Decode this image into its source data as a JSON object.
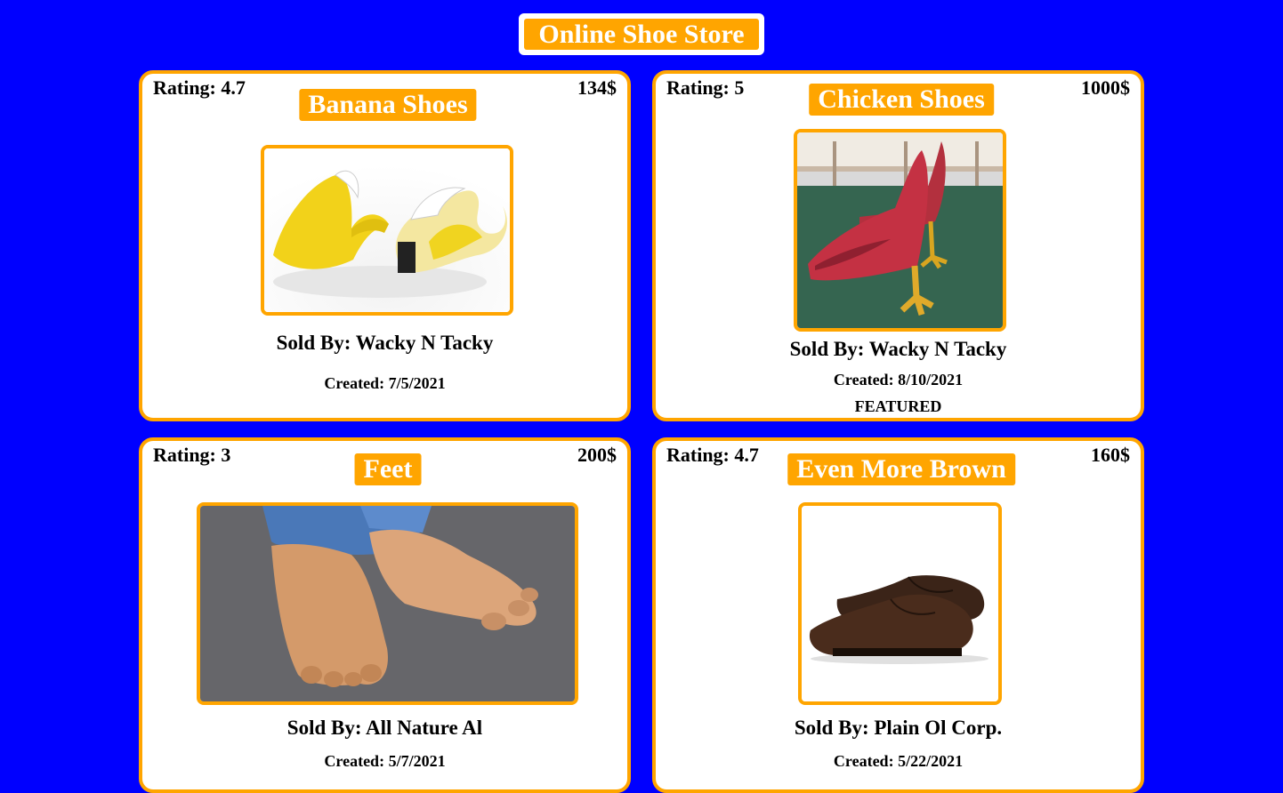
{
  "store": {
    "title": "Online Shoe Store"
  },
  "colors": {
    "background": "#0000ff",
    "accent": "#ffa500",
    "card": "#ffffff",
    "text": "#000000"
  },
  "products": [
    {
      "rating": "Rating: 4.7",
      "price": "134$",
      "name": "Banana Shoes",
      "seller": "Sold By: Wacky N Tacky",
      "created": "Created: 7/5/2021",
      "featured": "",
      "image_icon": "banana-shoes-image"
    },
    {
      "rating": "Rating: 5",
      "price": "1000$",
      "name": "Chicken Shoes",
      "seller": "Sold By: Wacky N Tacky",
      "created": "Created: 8/10/2021",
      "featured": "FEATURED",
      "image_icon": "chicken-shoes-image"
    },
    {
      "rating": "Rating: 3",
      "price": "200$",
      "name": "Feet",
      "seller": "Sold By: All Nature Al",
      "created": "Created: 5/7/2021",
      "featured": "",
      "image_icon": "feet-shoes-image"
    },
    {
      "rating": "Rating: 4.7",
      "price": "160$",
      "name": "Even More Brown",
      "seller": "Sold By: Plain Ol Corp.",
      "created": "Created: 5/22/2021",
      "featured": "",
      "image_icon": "brown-oxford-shoes-image"
    }
  ]
}
